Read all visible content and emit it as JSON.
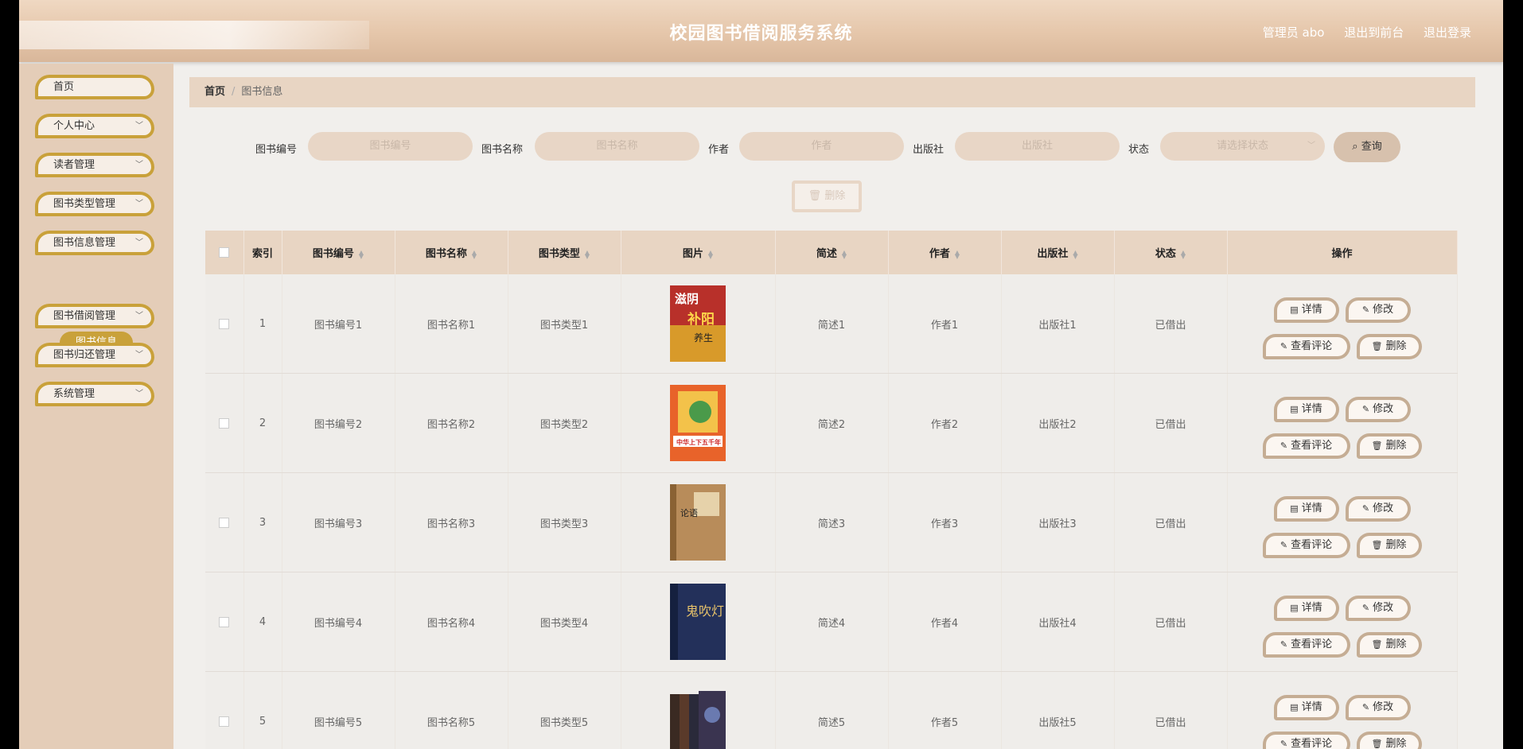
{
  "header": {
    "title": "校园图书借阅服务系统",
    "user": "管理员 abo",
    "to_front": "退出到前台",
    "logout": "退出登录"
  },
  "sidebar": {
    "items": [
      {
        "label": "首页"
      },
      {
        "label": "个人中心"
      },
      {
        "label": "读者管理"
      },
      {
        "label": "图书类型管理"
      },
      {
        "label": "图书信息管理"
      },
      {
        "label": "图书借阅管理"
      },
      {
        "label": "图书归还管理"
      },
      {
        "label": "系统管理"
      }
    ],
    "active_sub": "图书信息"
  },
  "breadcrumb": {
    "home": "首页",
    "sep": "/",
    "current": "图书信息"
  },
  "search": {
    "book_no_label": "图书编号",
    "book_no_placeholder": "图书编号",
    "book_name_label": "图书名称",
    "book_name_placeholder": "图书名称",
    "author_label": "作者",
    "author_placeholder": "作者",
    "publisher_label": "出版社",
    "publisher_placeholder": "出版社",
    "status_label": "状态",
    "status_placeholder": "请选择状态",
    "query_button": "查询",
    "batch_delete_button": "删除"
  },
  "table": {
    "headers": [
      "索引",
      "图书编号",
      "图书名称",
      "图书类型",
      "图片",
      "简述",
      "作者",
      "出版社",
      "状态",
      "操作"
    ],
    "rows": [
      {
        "index": "1",
        "book_no": "图书编号1",
        "name": "图书名称1",
        "type": "图书类型1",
        "desc": "简述1",
        "author": "作者1",
        "publisher": "出版社1",
        "status": "已借出"
      },
      {
        "index": "2",
        "book_no": "图书编号2",
        "name": "图书名称2",
        "type": "图书类型2",
        "desc": "简述2",
        "author": "作者2",
        "publisher": "出版社2",
        "status": "已借出"
      },
      {
        "index": "3",
        "book_no": "图书编号3",
        "name": "图书名称3",
        "type": "图书类型3",
        "desc": "简述3",
        "author": "作者3",
        "publisher": "出版社3",
        "status": "已借出"
      },
      {
        "index": "4",
        "book_no": "图书编号4",
        "name": "图书名称4",
        "type": "图书类型4",
        "desc": "简述4",
        "author": "作者4",
        "publisher": "出版社4",
        "status": "已借出"
      },
      {
        "index": "5",
        "book_no": "图书编号5",
        "name": "图书名称5",
        "type": "图书类型5",
        "desc": "简述5",
        "author": "作者5",
        "publisher": "出版社5",
        "status": "已借出"
      }
    ],
    "actions": {
      "detail": "详情",
      "edit": "修改",
      "comments": "查看评论",
      "delete": "删除"
    }
  },
  "cover_art": {
    "book1": {
      "line1": "滋阴",
      "line2": "补阳",
      "line3": "养生"
    },
    "book2": {
      "line1": "中华上下五千年"
    },
    "book3": {
      "line1": "论语"
    },
    "book4": {
      "line1": "鬼吹灯"
    }
  },
  "colors": {
    "accent": "#c9a13a",
    "header": "#e5c6aa",
    "sidebar": "#e4cdb8",
    "table_header": "#e8d5c3"
  }
}
